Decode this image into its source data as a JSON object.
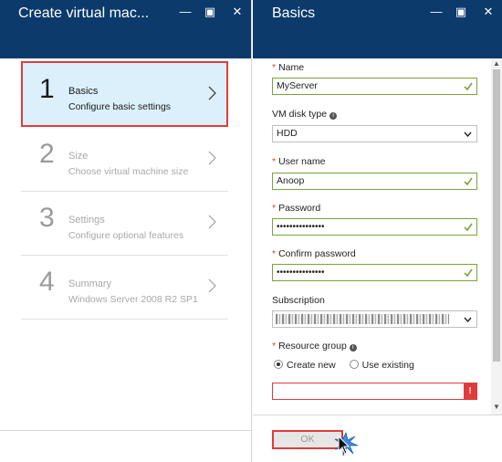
{
  "left_blade": {
    "title": "Create virtual mac...",
    "controls": {
      "minimize": "—",
      "maximize": "▣",
      "close": "✕"
    },
    "steps": [
      {
        "number": "1",
        "title": "Basics",
        "subtitle": "Configure basic settings",
        "active": true
      },
      {
        "number": "2",
        "title": "Size",
        "subtitle": "Choose virtual machine size",
        "active": false
      },
      {
        "number": "3",
        "title": "Settings",
        "subtitle": "Configure optional features",
        "active": false
      },
      {
        "number": "4",
        "title": "Summary",
        "subtitle": "Windows Server 2008 R2 SP1",
        "active": false
      }
    ]
  },
  "right_blade": {
    "title": "Basics",
    "controls": {
      "minimize": "—",
      "maximize": "▣",
      "close": "✕"
    },
    "form": {
      "name": {
        "label": "Name",
        "value": "MyServer"
      },
      "disk_type": {
        "label": "VM disk type",
        "value": "HDD"
      },
      "user_name": {
        "label": "User name",
        "value": "Anoop"
      },
      "password": {
        "label": "Password",
        "value": "•••••••••••••••"
      },
      "confirm_password": {
        "label": "Confirm password",
        "value": "•••••••••••••••"
      },
      "subscription": {
        "label": "Subscription"
      },
      "resource_group": {
        "label": "Resource group",
        "option_new": "Create new",
        "option_existing": "Use existing",
        "error_mark": "!"
      }
    },
    "ok_button": "OK"
  },
  "colors": {
    "header": "#0b3a6b",
    "active_step": "#dcf0fb",
    "highlight": "#e03c3c",
    "valid": "#7aa33a"
  }
}
